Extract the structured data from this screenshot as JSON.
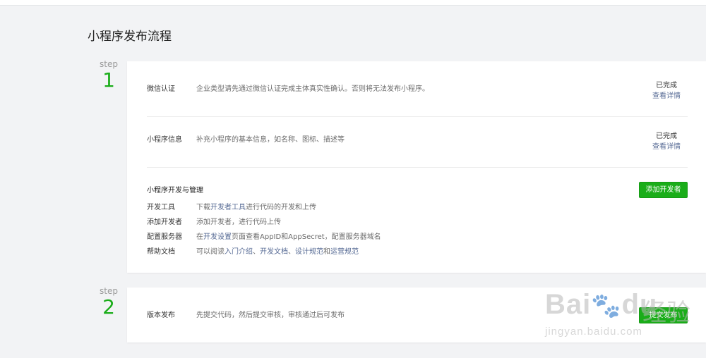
{
  "page": {
    "title": "小程序发布流程"
  },
  "steps": [
    {
      "word": "step",
      "number": "1"
    },
    {
      "word": "step",
      "number": "2"
    }
  ],
  "card1": {
    "wechat_cert": {
      "label": "微信认证",
      "desc": "企业类型请先通过微信认证完成主体真实性确认。否则将无法发布小程序。",
      "status": "已完成",
      "link": "查看详情"
    },
    "mp_info": {
      "label": "小程序信息",
      "desc": "补充小程序的基本信息，如名称、图标、描述等",
      "status": "已完成",
      "link": "查看详情"
    },
    "dev": {
      "title": "小程序开发与管理",
      "button": "添加开发者",
      "tools": {
        "label": "开发工具",
        "pre": "下载",
        "link": "开发者工具",
        "post": "进行代码的开发和上传"
      },
      "add_dev": {
        "label": "添加开发者",
        "desc": "添加开发者，进行代码上传"
      },
      "server": {
        "label": "配置服务器",
        "pre": "在",
        "link": "开发设置",
        "post": "页面查看AppID和AppSecret，配置服务器域名"
      },
      "docs": {
        "label": "帮助文档",
        "pre": "可以阅读",
        "link1": "入门介绍",
        "sep1": "、",
        "link2": "开发文档",
        "sep2": "、",
        "link3": "设计规范",
        "sep3": "和",
        "link4": "运营规范"
      }
    }
  },
  "card2": {
    "release": {
      "label": "版本发布",
      "desc": "先提交代码，然后提交审核，审核通过后可发布",
      "button": "提交发布"
    }
  },
  "watermark": {
    "logo": "Bai",
    "paw": "du",
    "cn": "经验",
    "url": "jingyan.baidu.com"
  },
  "colors": {
    "accent": "#1aad19",
    "link": "#576b95",
    "background": "#f2f3f5"
  }
}
